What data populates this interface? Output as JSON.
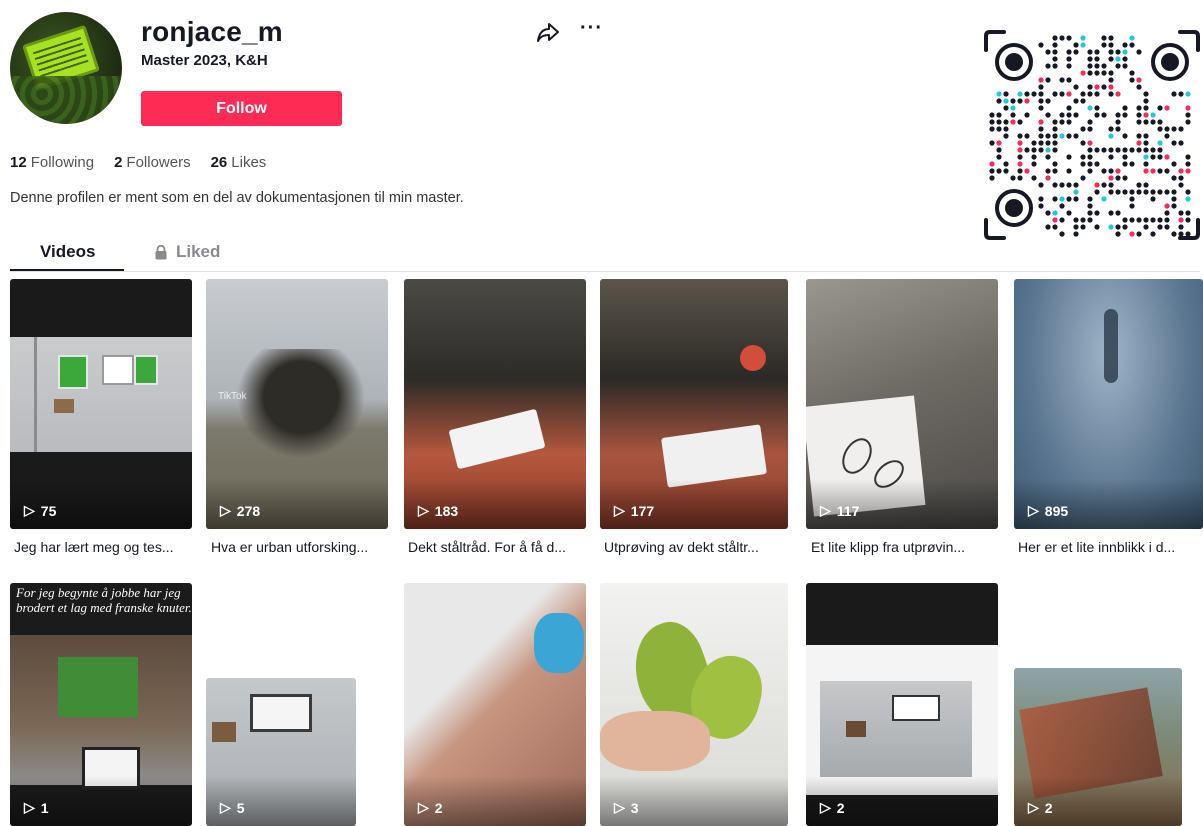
{
  "profile": {
    "username": "ronjace_m",
    "subtitle": "Master 2023, K&H",
    "follow_label": "Follow",
    "bio": "Denne profilen er ment som en del av dokumentasjonen til min master.",
    "avatar_sign_text": "MOSEGRAFFITI"
  },
  "stats": {
    "following_count": "12",
    "following_label": "Following",
    "followers_count": "2",
    "followers_label": "Followers",
    "likes_count": "26",
    "likes_label": "Likes"
  },
  "actions": {
    "share_icon": "share-icon",
    "more_icon": "more-icon",
    "more_label": "···"
  },
  "tabs": [
    {
      "label": "Videos",
      "active": true
    },
    {
      "label": "Liked",
      "active": false,
      "icon": "lock-icon"
    }
  ],
  "videos": [
    {
      "views": "75",
      "caption": "Jeg har lært meg og tes..."
    },
    {
      "views": "278",
      "caption": "Hva er urban utforsking...",
      "overlay_text": "TikTok"
    },
    {
      "views": "183",
      "caption": "Dekt ståltråd. For å få d..."
    },
    {
      "views": "177",
      "caption": "Utprøving av dekt ståltr..."
    },
    {
      "views": "117",
      "caption": "Et lite klipp fra utprøvin..."
    },
    {
      "views": "895",
      "caption": "Her er et lite innblikk i d..."
    },
    {
      "views": "1",
      "overlay_text": "For jeg begynte å jobbe har jeg brodert et lag med franske knuter."
    },
    {
      "views": "5"
    },
    {
      "views": "2"
    },
    {
      "views": "3"
    },
    {
      "views": "2"
    },
    {
      "views": "2"
    }
  ],
  "colors": {
    "accent": "#fe2c55",
    "text": "#161823",
    "muted": "#8a8b91"
  }
}
